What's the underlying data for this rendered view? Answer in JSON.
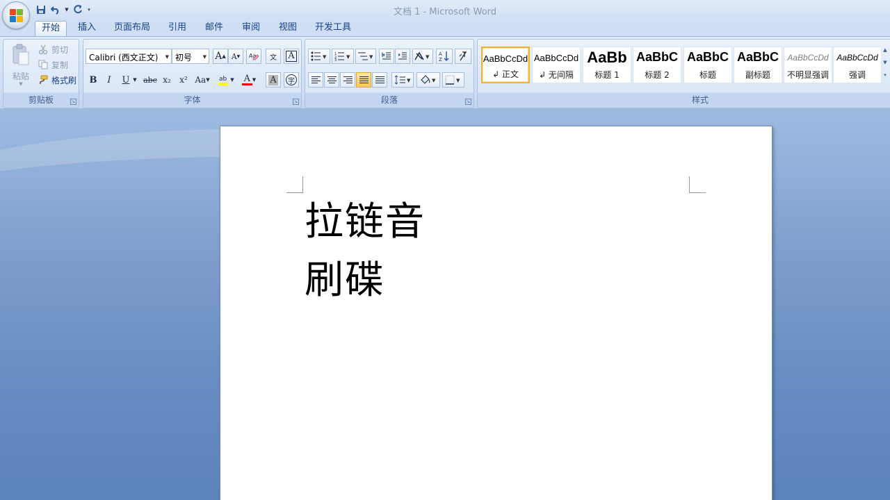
{
  "window": {
    "title": "文档 1 - Microsoft Word"
  },
  "tabs": [
    "开始",
    "插入",
    "页面布局",
    "引用",
    "邮件",
    "审阅",
    "视图",
    "开发工具"
  ],
  "clipboard": {
    "label": "剪贴板",
    "paste": "粘贴",
    "cut": "剪切",
    "copy": "复制",
    "format_painter": "格式刷"
  },
  "font": {
    "label": "字体",
    "family": "Calibri (西文正文)",
    "size": "初号",
    "grow": "A",
    "shrink": "A",
    "bold": "B",
    "italic": "I",
    "underline": "U",
    "strike": "abc",
    "subscript": "x₂",
    "superscript": "x²",
    "case": "Aa",
    "char_shading": "A",
    "font_color": "A",
    "phonetic": "文",
    "char_border": "A",
    "enclose": "字"
  },
  "paragraph": {
    "label": "段落"
  },
  "styles": {
    "label": "样式",
    "items": [
      {
        "sample": "AaBbCcDd",
        "name": "↲ 正文"
      },
      {
        "sample": "AaBbCcDd",
        "name": "↲ 无间隔"
      },
      {
        "sample": "AaBb",
        "name": "标题 1"
      },
      {
        "sample": "AaBbC",
        "name": "标题 2"
      },
      {
        "sample": "AaBbC",
        "name": "标题"
      },
      {
        "sample": "AaBbC",
        "name": "副标题"
      },
      {
        "sample": "AaBbCcDd",
        "name": "不明显强调"
      },
      {
        "sample": "AaBbCcDd",
        "name": "强调"
      }
    ]
  },
  "document": {
    "lines": [
      "拉链音",
      "刷碟"
    ]
  },
  "colors": {
    "highlight": "#ffff00",
    "font_color": "#ff0000",
    "selection": "#f0b03a"
  }
}
